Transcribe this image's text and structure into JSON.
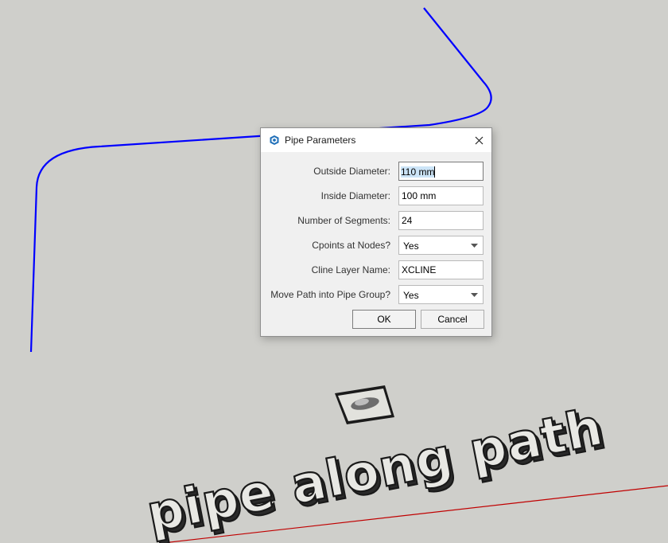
{
  "dialog": {
    "title": "Pipe Parameters",
    "fields": {
      "outside_diameter": {
        "label": "Outside Diameter:",
        "value": "110 mm"
      },
      "inside_diameter": {
        "label": "Inside Diameter:",
        "value": "100 mm"
      },
      "segments": {
        "label": "Number of Segments:",
        "value": "24"
      },
      "cpoints": {
        "label": "Cpoints at Nodes?",
        "value": "Yes"
      },
      "cline_layer": {
        "label": "Cline Layer Name:",
        "value": "XCLINE"
      },
      "move_path": {
        "label": "Move Path into Pipe Group?",
        "value": "Yes"
      }
    },
    "buttons": {
      "ok": "OK",
      "cancel": "Cancel"
    }
  },
  "scene": {
    "text_3d": "pipe along path",
    "path_color": "#0000ff",
    "axis_color": "#c00000"
  },
  "icons": [
    "sketchup-icon",
    "close-icon",
    "dropdown-arrow-icon"
  ]
}
